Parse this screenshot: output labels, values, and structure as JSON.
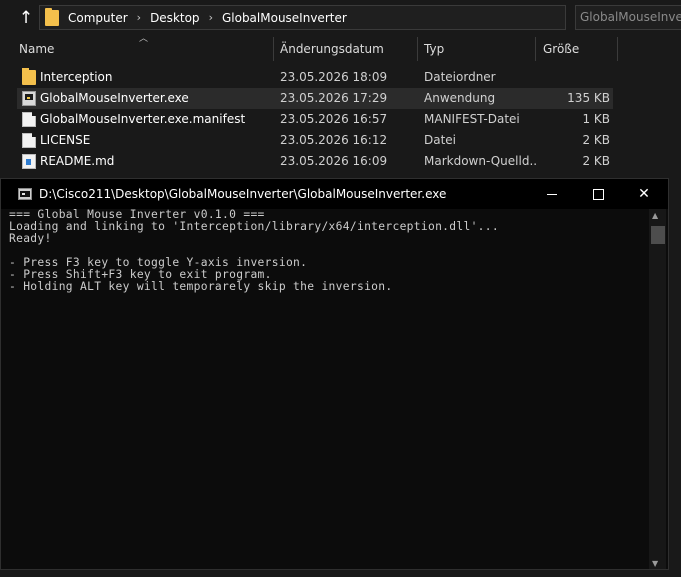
{
  "explorer": {
    "breadcrumbs": [
      "Computer",
      "Desktop",
      "GlobalMouseInverter"
    ],
    "crumb_separator": "›",
    "search_placeholder": "GlobalMouseInverter durchsuchen",
    "columns": {
      "name": "Name",
      "date": "Änderungsdatum",
      "type": "Typ",
      "size": "Größe"
    },
    "files": [
      {
        "name": "Interception",
        "date": "23.05.2026 18:09",
        "type": "Dateiordner",
        "size": "",
        "icon": "folder-icon"
      },
      {
        "name": "GlobalMouseInverter.exe",
        "date": "23.05.2026 17:29",
        "type": "Anwendung",
        "size": "135 KB",
        "icon": "exe-icon"
      },
      {
        "name": "GlobalMouseInverter.exe.manifest",
        "date": "23.05.2026 16:57",
        "type": "MANIFEST-Datei",
        "size": "1 KB",
        "icon": "document-icon"
      },
      {
        "name": "LICENSE",
        "date": "23.05.2026 16:12",
        "type": "Datei",
        "size": "2 KB",
        "icon": "document-icon"
      },
      {
        "name": "README.md",
        "date": "23.05.2026 16:09",
        "type": "Markdown-Quelld...",
        "size": "2 KB",
        "icon": "markdown-icon"
      }
    ]
  },
  "console": {
    "title": "D:\\Cisco211\\Desktop\\GlobalMouseInverter\\GlobalMouseInverter.exe",
    "lines": [
      "=== Global Mouse Inverter v0.1.0 ===",
      "Loading and linking to 'Interception/library/x64/interception.dll'...",
      "Ready!",
      "",
      "- Press F3 key to toggle Y-axis inversion.",
      "- Press Shift+F3 key to exit program.",
      "- Holding ALT key will temporarely skip the inversion."
    ]
  },
  "colors": {
    "explorer_bg": "#191919",
    "console_bg": "#0c0c0c",
    "folder": "#f4c04c",
    "selected_row": "#2b2b2b"
  }
}
